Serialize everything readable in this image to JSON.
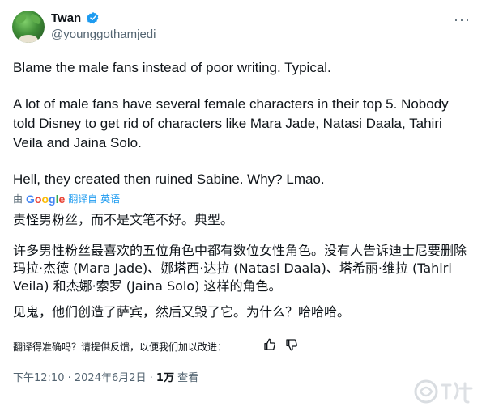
{
  "author": {
    "name": "Twan",
    "handle": "@younggothamjedi"
  },
  "menu_icon": "more-dots-icon",
  "tweet": {
    "p1": "Blame the male fans instead of poor writing. Typical.",
    "p2": "A lot of male fans have several female characters in their top 5. Nobody told Disney to get rid of characters like Mara Jade, Natasi Daala, Tahiri Veila and Jaina Solo.",
    "p3": "Hell, they created then ruined Sabine. Why? Lmao."
  },
  "translation": {
    "by": "由",
    "google": [
      "G",
      "o",
      "o",
      "g",
      "l",
      "e"
    ],
    "google_colors": [
      "#4285f4",
      "#ea4335",
      "#fbbc05",
      "#4285f4",
      "#34a853",
      "#ea4335"
    ],
    "translated_from": "翻译自",
    "language": "英语",
    "p1": "责怪男粉丝，而不是文笔不好。典型。",
    "p2": "许多男性粉丝最喜欢的五位角色中都有数位女性角色。没有人告诉迪士尼要删除玛拉·杰德 (Mara Jade)、娜塔西·达拉 (Natasi Daala)、塔希丽·维拉 (Tahiri Veila) 和杰娜·索罗 (Jaina Solo) 这样的角色。",
    "p3": "见鬼，他们创造了萨宾，然后又毁了它。为什么？哈哈哈。",
    "feedback_question": "翻译得准确吗？请提供反馈，以便我们加以改进："
  },
  "meta": {
    "time": "下午12:10",
    "date": "2024年6月2日",
    "views_count": "1万",
    "views_label": "查看"
  },
  "colors": {
    "verified": "#1d9bf0",
    "link": "#1d9bf0",
    "secondary": "#536471"
  }
}
